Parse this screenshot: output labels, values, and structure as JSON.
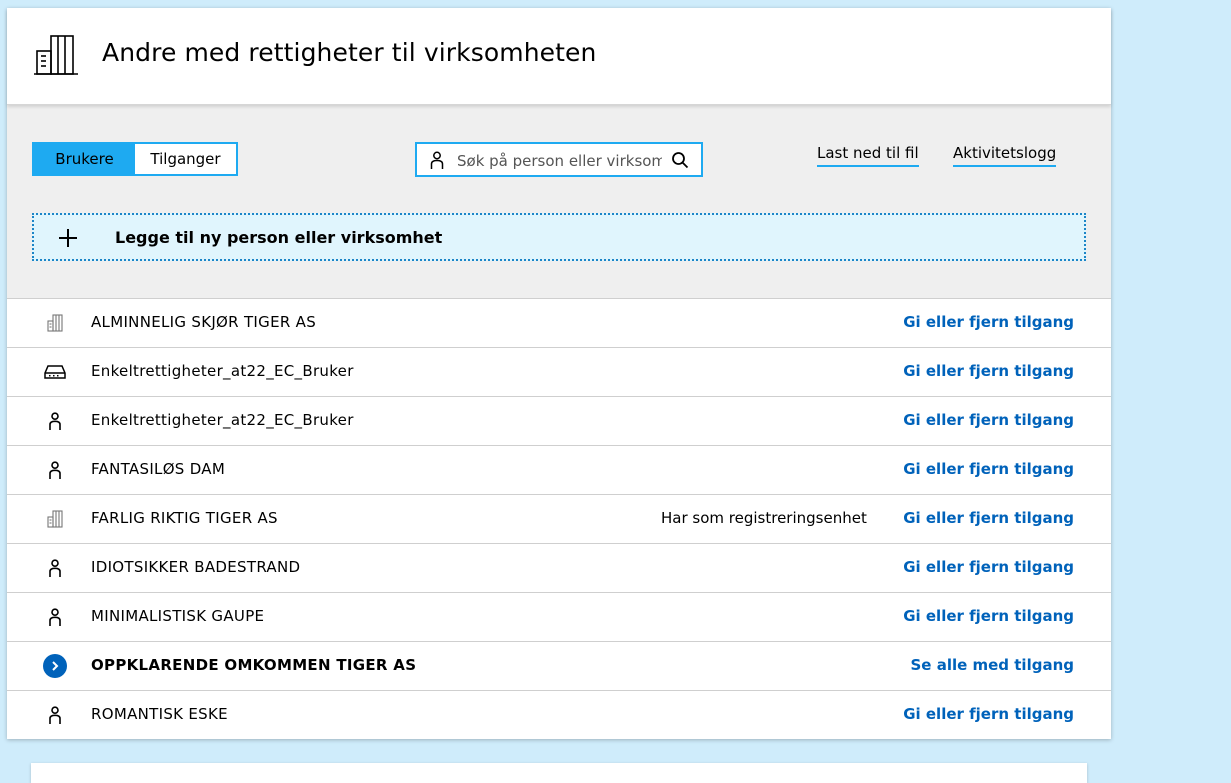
{
  "header": {
    "title": "Andre med rettigheter til virksomheten",
    "icon": "building-icon"
  },
  "toolbar": {
    "toggle": {
      "users_label": "Brukere",
      "access_label": "Tilganger",
      "active": "Brukere"
    },
    "search": {
      "placeholder": "Søk på person eller virksom"
    },
    "download_label": "Last ned til fil",
    "activity_label": "Aktivitetslogg"
  },
  "add": {
    "label": "Legge til ny person eller virksomhet"
  },
  "rows": [
    {
      "icon": "building-icon",
      "name": "ALMINNELIG SKJØR TIGER AS",
      "note": "",
      "action": "Gi eller fjern tilgang"
    },
    {
      "icon": "system-icon",
      "name": "Enkeltrettigheter_at22_EC_Bruker",
      "note": "",
      "action": "Gi eller fjern tilgang"
    },
    {
      "icon": "person-icon",
      "name": "Enkeltrettigheter_at22_EC_Bruker",
      "note": "",
      "action": "Gi eller fjern tilgang"
    },
    {
      "icon": "person-icon",
      "name": "FANTASILØS DAM",
      "note": "",
      "action": "Gi eller fjern tilgang"
    },
    {
      "icon": "building-icon",
      "name": "FARLIG RIKTIG TIGER AS",
      "note": "Har som registreringsenhet",
      "action": "Gi eller fjern tilgang"
    },
    {
      "icon": "person-icon",
      "name": "IDIOTSIKKER BADESTRAND",
      "note": "",
      "action": "Gi eller fjern tilgang"
    },
    {
      "icon": "person-icon",
      "name": "MINIMALISTISK GAUPE",
      "note": "",
      "action": "Gi eller fjern tilgang"
    },
    {
      "icon": "chevron-right-icon",
      "name": "OPPKLARENDE OMKOMMEN TIGER AS",
      "note": "",
      "action": "Se alle med tilgang"
    },
    {
      "icon": "person-icon",
      "name": "ROMANTISK ESKE",
      "note": "",
      "action": "Gi eller fjern tilgang"
    }
  ]
}
